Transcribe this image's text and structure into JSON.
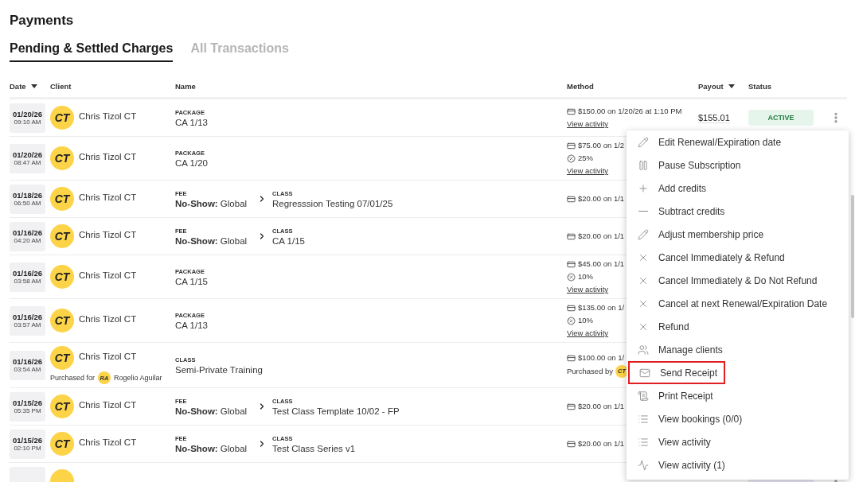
{
  "page": {
    "title": "Payments"
  },
  "tabs": [
    {
      "label": "Pending & Settled Charges",
      "selected": true
    },
    {
      "label": "All Transactions",
      "selected": false
    }
  ],
  "table": {
    "columns": [
      {
        "label": "Date",
        "sortable": true
      },
      {
        "label": "Client",
        "sortable": false
      },
      {
        "label": "Name",
        "sortable": false
      },
      {
        "label": "Method",
        "sortable": false
      },
      {
        "label": "Payout",
        "sortable": true
      },
      {
        "label": "Status",
        "sortable": false
      }
    ],
    "rows": [
      {
        "date": "01/20/26",
        "time": "09:10 AM",
        "avatar": "CT",
        "client": "Chris Tizol CT",
        "items": [
          {
            "type": "PACKAGE",
            "name": "CA 1/13"
          }
        ],
        "method": {
          "amount": "$150.00 on 1/20/26 at 1:10 PM",
          "link": "View activity"
        },
        "payout": "$155.01",
        "status": {
          "label": "ACTIVE",
          "kind": "active"
        },
        "actions": true
      },
      {
        "date": "01/20/26",
        "time": "08:47 AM",
        "avatar": "CT",
        "client": "Chris Tizol CT",
        "items": [
          {
            "type": "PACKAGE",
            "name": "CA 1/20"
          }
        ],
        "method": {
          "amount": "$75.00 on 1/2",
          "discount": "25%",
          "link": "View activity"
        }
      },
      {
        "date": "01/18/26",
        "time": "06:50 AM",
        "avatar": "CT",
        "client": "Chris Tizol CT",
        "items": [
          {
            "type": "FEE",
            "name": "**No-Show:** Global"
          },
          {
            "type": "CLASS",
            "name": "Regresssion Testing 07/01/25"
          }
        ],
        "method": {
          "amount": "$20.00 on 1/1"
        }
      },
      {
        "date": "01/16/26",
        "time": "04:20 AM",
        "avatar": "CT",
        "client": "Chris Tizol CT",
        "items": [
          {
            "type": "FEE",
            "name": "**No-Show:** Global"
          },
          {
            "type": "CLASS",
            "name": "CA 1/15"
          }
        ],
        "method": {
          "amount": "$20.00 on 1/1"
        }
      },
      {
        "date": "01/16/26",
        "time": "03:58 AM",
        "avatar": "CT",
        "client": "Chris Tizol CT",
        "items": [
          {
            "type": "PACKAGE",
            "name": "CA 1/15"
          }
        ],
        "method": {
          "amount": "$45.00 on 1/1",
          "discount": "10%",
          "link": "View activity"
        }
      },
      {
        "date": "01/16/26",
        "time": "03:57 AM",
        "avatar": "CT",
        "client": "Chris Tizol CT",
        "items": [
          {
            "type": "PACKAGE",
            "name": "CA 1/13"
          }
        ],
        "method": {
          "amount": "$135.00 on 1/",
          "discount": "10%",
          "link": "View activity"
        }
      },
      {
        "date": "01/16/26",
        "time": "03:54 AM",
        "avatar": "CT",
        "client": "Chris Tizol CT",
        "purchased_for": {
          "label": "Purchased for",
          "avatar": "RA",
          "name": "Rogelio Aguilar"
        },
        "items": [
          {
            "type": "CLASS",
            "name": "Semi-Private Training"
          }
        ],
        "method": {
          "amount": "$100.00 on 1/",
          "purchased_by": {
            "label": "Purchased by",
            "avatar": "CT"
          }
        }
      },
      {
        "date": "01/15/26",
        "time": "05:35 PM",
        "avatar": "CT",
        "client": "Chris Tizol CT",
        "items": [
          {
            "type": "FEE",
            "name": "**No-Show:** Global"
          },
          {
            "type": "CLASS",
            "name": "Test Class Template 10/02 - FP"
          }
        ],
        "method": {
          "amount": "$20.00 on 1/1"
        }
      },
      {
        "date": "01/15/26",
        "time": "02:10 PM",
        "avatar": "CT",
        "client": "Chris Tizol CT",
        "items": [
          {
            "type": "FEE",
            "name": "**No-Show:** Global"
          },
          {
            "type": "CLASS",
            "name": "Test Class Series v1"
          }
        ],
        "method": {
          "amount": "$20.00 on 1/1"
        }
      },
      {
        "status": {
          "kind": "terminated"
        },
        "actions": true
      }
    ]
  },
  "menu": {
    "items": [
      {
        "kind": "edit",
        "label": "Edit Renewal/Expiration date",
        "highlighted": false
      },
      {
        "kind": "pause",
        "label": "Pause Subscription",
        "highlighted": false
      },
      {
        "kind": "add",
        "label": "Add credits",
        "highlighted": false
      },
      {
        "kind": "subtract",
        "label": "Subtract credits",
        "highlighted": false
      },
      {
        "kind": "edit",
        "label": "Adjust membership price",
        "highlighted": false
      },
      {
        "kind": "cancel",
        "label": "Cancel Immediately & Refund",
        "highlighted": false
      },
      {
        "kind": "cancel",
        "label": "Cancel Immediately & Do Not Refund",
        "highlighted": false
      },
      {
        "kind": "cancel",
        "label": "Cancel at next Renewal/Expiration Date",
        "highlighted": false
      },
      {
        "kind": "cancel",
        "label": "Refund",
        "highlighted": false
      },
      {
        "kind": "clients",
        "label": "Manage clients",
        "highlighted": false
      },
      {
        "kind": "email",
        "label": "Send Receipt",
        "highlighted": true
      },
      {
        "kind": "print",
        "label": "Print Receipt",
        "highlighted": false
      },
      {
        "kind": "list",
        "label": "View bookings (0/0)",
        "highlighted": false
      },
      {
        "kind": "list",
        "label": "View activity",
        "highlighted": false
      },
      {
        "kind": "activity",
        "label": "View activity (1)",
        "highlighted": false
      }
    ]
  }
}
